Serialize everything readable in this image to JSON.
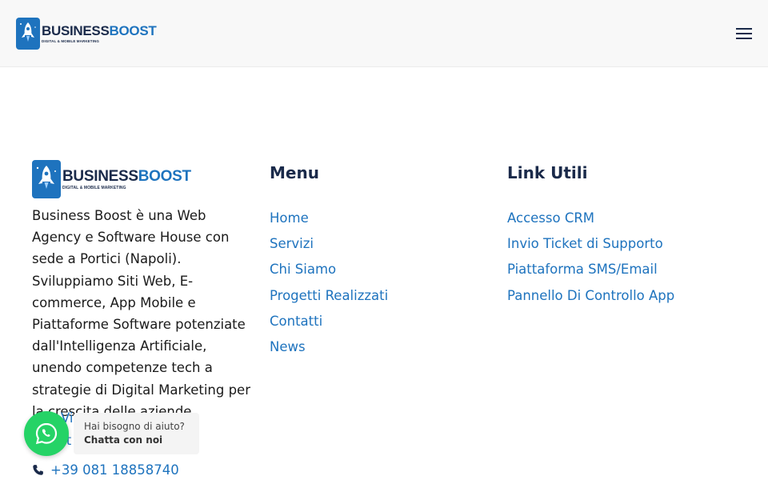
{
  "brand": {
    "name_part1": "BUSINESS",
    "name_part2": "BOOST",
    "tagline": "DIGITAL & MOBILE MARKETING",
    "color_primary": "#1e73be",
    "color_dark": "#1a2a4a"
  },
  "header": {
    "menu_icon": "hamburger-icon"
  },
  "footer": {
    "about_text": "Business Boost è una Web Agency e Software House con sede a Portici (Napoli). Sviluppiamo Siti Web, E-commerce, App Mobile e Piattaforme Software potenziate dall'Intelligenza Artificiale, unendo competenze tech a strategie di Digital Marketing per la crescita delle aziende.",
    "contact": {
      "address_line1": "Via",
      "address_line2": "rt",
      "phone": "+39 081 18858740"
    },
    "menu": {
      "title": "Menu",
      "items": [
        "Home",
        "Servizi",
        "Chi Siamo",
        "Progetti Realizzati",
        "Contatti",
        "News"
      ]
    },
    "links": {
      "title": "Link Utili",
      "items": [
        "Accesso CRM",
        "Invio Ticket di Supporto",
        "Piattaforma SMS/Email",
        "Pannello Di Controllo App"
      ]
    }
  },
  "whatsapp": {
    "question": "Hai bisogno di aiuto?",
    "cta": "Chatta con noi",
    "color": "#25d366"
  }
}
